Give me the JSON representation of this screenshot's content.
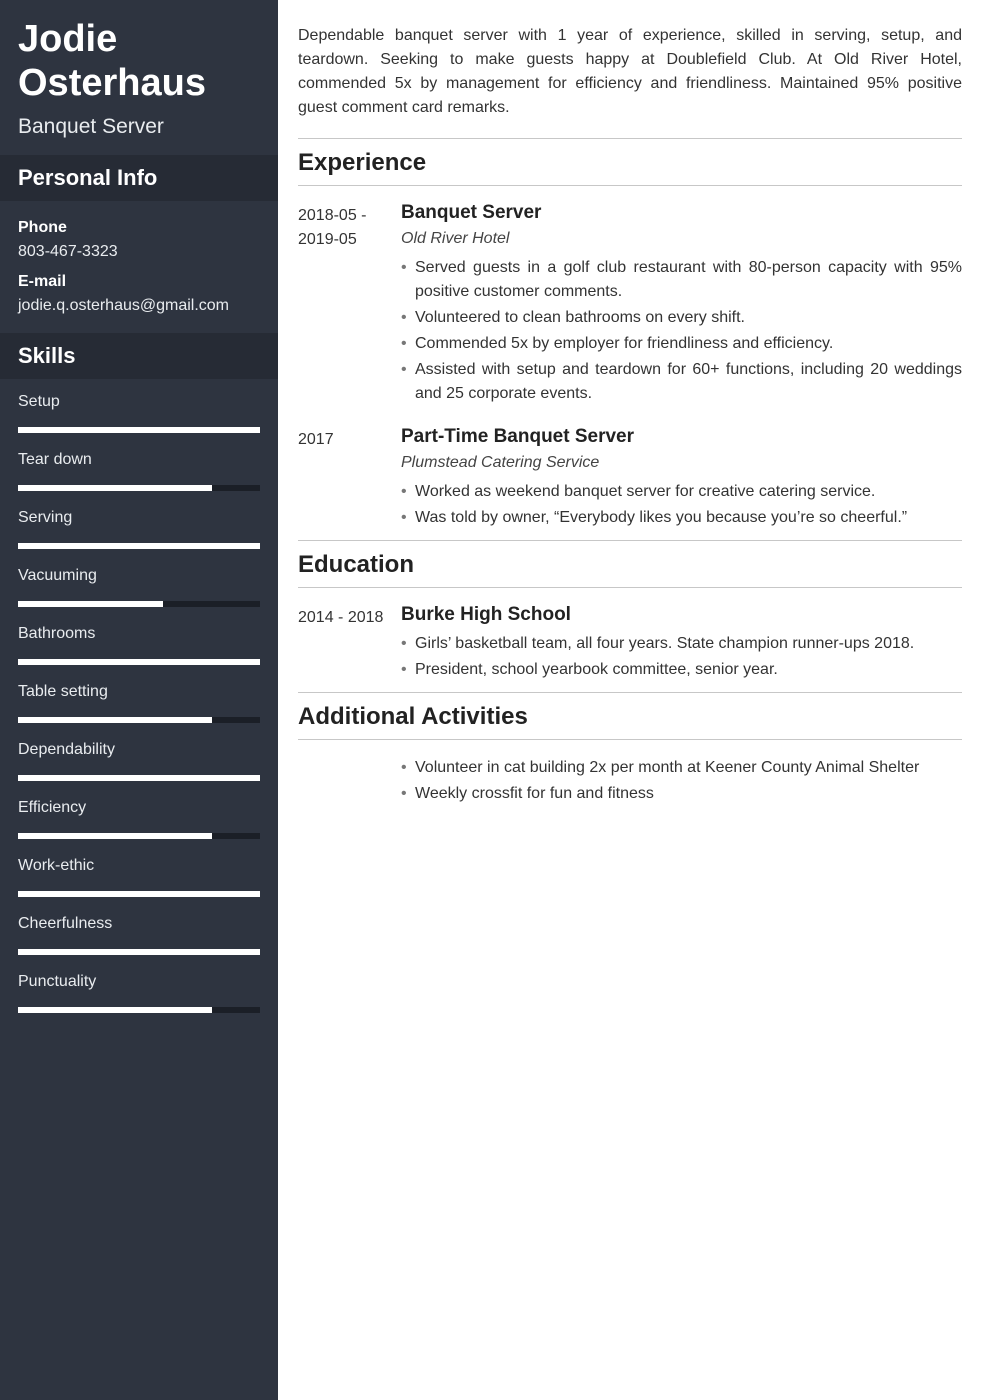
{
  "name": "Jodie Osterhaus",
  "job_title": "Banquet Server",
  "personal_info_heading": "Personal Info",
  "phone_label": "Phone",
  "phone_value": "803-467-3323",
  "email_label": "E-mail",
  "email_value": "jodie.q.osterhaus@gmail.com",
  "skills_heading": "Skills",
  "skills": [
    {
      "label": "Setup",
      "pct": 100
    },
    {
      "label": "Tear down",
      "pct": 80
    },
    {
      "label": "Serving",
      "pct": 100
    },
    {
      "label": "Vacuuming",
      "pct": 60
    },
    {
      "label": "Bathrooms",
      "pct": 100
    },
    {
      "label": "Table setting",
      "pct": 80
    },
    {
      "label": "Dependability",
      "pct": 100
    },
    {
      "label": "Efficiency",
      "pct": 80
    },
    {
      "label": "Work-ethic",
      "pct": 100
    },
    {
      "label": "Cheerfulness",
      "pct": 100
    },
    {
      "label": "Punctuality",
      "pct": 80
    }
  ],
  "summary": "Dependable banquet server with 1 year of experience, skilled in serving, setup, and teardown. Seeking to make guests happy at Doublefield Club. At Old River Hotel, commended 5x by management for efficiency and friendliness. Maintained 95% positive guest comment card remarks.",
  "experience_heading": "Experience",
  "experience": [
    {
      "dates": "2018-05 - 2019-05",
      "title": "Banquet Server",
      "sub": "Old River Hotel",
      "bullets": [
        "Served guests in a golf club restaurant with 80-person capacity with 95% positive customer comments.",
        "Volunteered to clean bathrooms on every shift.",
        "Commended 5x by employer for friendliness and efficiency.",
        "Assisted with setup and teardown for 60+ functions, including 20 weddings and 25 corporate events."
      ]
    },
    {
      "dates": "2017",
      "title": "Part-Time Banquet Server",
      "sub": "Plumstead Catering Service",
      "bullets": [
        "Worked as weekend banquet server for creative catering service.",
        "Was told by owner, “Everybody likes you because you’re so cheerful.”"
      ]
    }
  ],
  "education_heading": "Education",
  "education": [
    {
      "dates": "2014 - 2018",
      "title": "Burke High School",
      "bullets": [
        "Girls’ basketball team, all four years. State champion runner-ups 2018.",
        "President, school yearbook committee, senior year."
      ]
    }
  ],
  "activities_heading": "Additional Activities",
  "activities": [
    "Volunteer in cat building 2x per month at Keener County Animal Shelter",
    "Weekly crossfit for fun and fitness"
  ]
}
